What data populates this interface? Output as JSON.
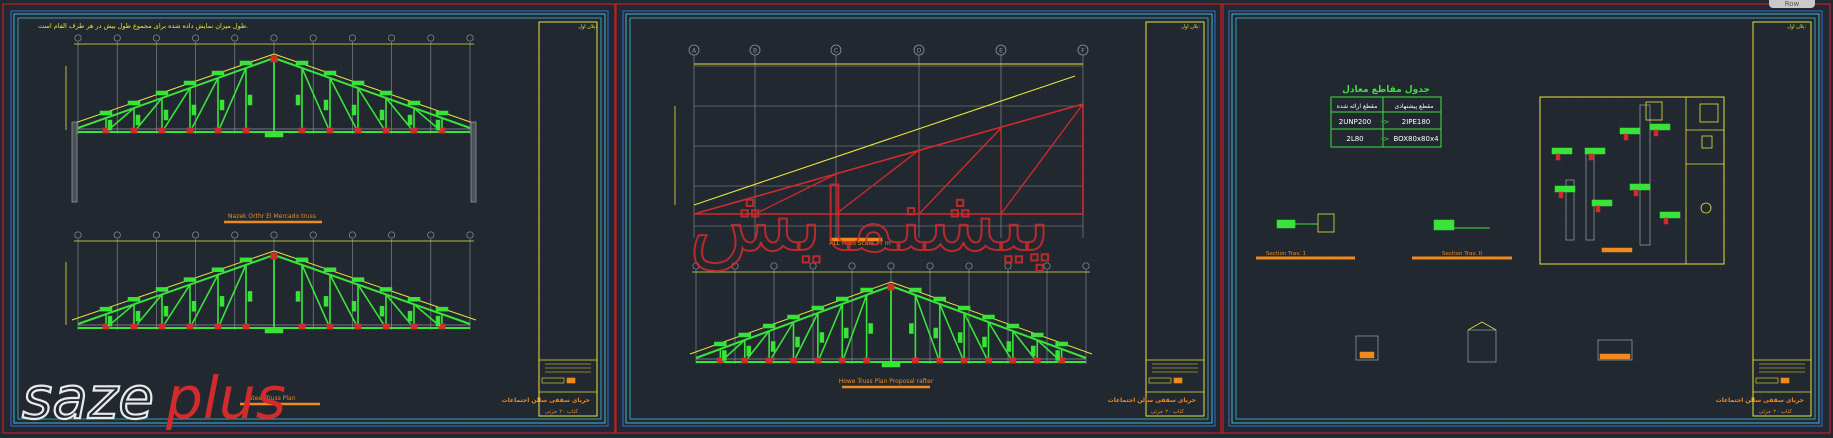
{
  "colors": {
    "background": "#212830",
    "sheet_border_red": "#c0202a",
    "frame_cyan": "#3fb9d6",
    "frame_blue": "#2f6fd8",
    "yellow": "#e6e43a",
    "green": "#39e339",
    "red_member": "#d12b2b",
    "grid_grey": "#8f949a",
    "orange": "#f08a1c",
    "watermark_white": "#e9e9e9",
    "watermark_red": "#d32b2b"
  },
  "corner_button": "Row",
  "sheet1": {
    "note": "طول میزان نمایش داده شده برای مجموع طول بیش در هر طرف الفام است.",
    "caption_top": "Nazek Orthr El Mercado truss",
    "caption_bottom": "Steel Truss Plan",
    "title_block": {
      "header": "پلان اول:",
      "title": "خرپای سقفی سالن اجتماعات",
      "subtitle": "کتاب ۲۰ جزئی"
    }
  },
  "sheet2": {
    "caption_top": "ALL RIBS Scale TT m",
    "caption_bottom": "Howe Truss Plan Proposal rafter",
    "grid_labels": [
      "A",
      "B",
      "C",
      "D",
      "E",
      "F"
    ],
    "title_block": {
      "header": "پلان اول:",
      "title": "خرپای سقفی سالن اجتماعات",
      "subtitle": "کتاب ۲۰ جزئی"
    }
  },
  "sheet3": {
    "table_title": "جدول مقاطع معادل",
    "table_headers": [
      "مقطع پیشنهادی",
      "مقطع ارائه شده"
    ],
    "table_rows": [
      {
        "proposed": "2IPE180",
        "arrow": "->",
        "given": "2UNP200"
      },
      {
        "proposed": "BOX80x80x4",
        "arrow": "->",
        "given": "2L80"
      }
    ],
    "section_a": "Section Trav. 1",
    "section_b": "Section Trav. II",
    "title_block": {
      "header": "پلان اول:",
      "title": "خرپای سقفی سالن اجتماعات",
      "subtitle": "کتاب ۲۰ جزئی"
    }
  },
  "watermark_left": {
    "part1": "saze",
    "part2": "plus"
  },
  "watermark_center": "پیشنمایش"
}
